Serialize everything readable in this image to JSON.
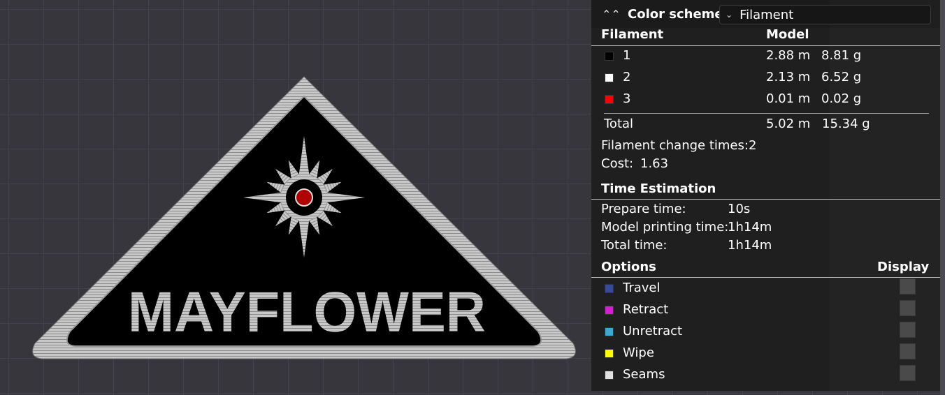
{
  "model": {
    "label_text": "MAYFLOWER"
  },
  "panel": {
    "color_scheme_label": "Color scheme",
    "color_scheme_value": "Filament",
    "filament_header": "Filament",
    "model_header": "Model",
    "filaments": [
      {
        "id": "1",
        "color": "#000000",
        "length": "2.88 m",
        "weight": "8.81 g"
      },
      {
        "id": "2",
        "color": "#ffffff",
        "length": "2.13 m",
        "weight": "6.52 g"
      },
      {
        "id": "3",
        "color": "#ff0000",
        "length": "0.01 m",
        "weight": "0.02 g"
      }
    ],
    "total": {
      "label": "Total",
      "length": "5.02 m",
      "weight": "15.34 g"
    },
    "filament_change_label": "Filament change times:",
    "filament_change_value": "2",
    "cost_label": "Cost:",
    "cost_value": "1.63",
    "time_header": "Time Estimation",
    "times": [
      {
        "label": "Prepare time:",
        "value": "10s"
      },
      {
        "label": "Model printing time:",
        "value": "1h14m"
      },
      {
        "label": "Total time:",
        "value": "1h14m"
      }
    ],
    "options_header": "Options",
    "display_header": "Display",
    "options": [
      {
        "label": "Travel",
        "color": "#3a4a9a"
      },
      {
        "label": "Retract",
        "color": "#d020d0"
      },
      {
        "label": "Unretract",
        "color": "#40a8d0"
      },
      {
        "label": "Wipe",
        "color": "#ffff00"
      },
      {
        "label": "Seams",
        "color": "#e0e0e0"
      }
    ]
  }
}
